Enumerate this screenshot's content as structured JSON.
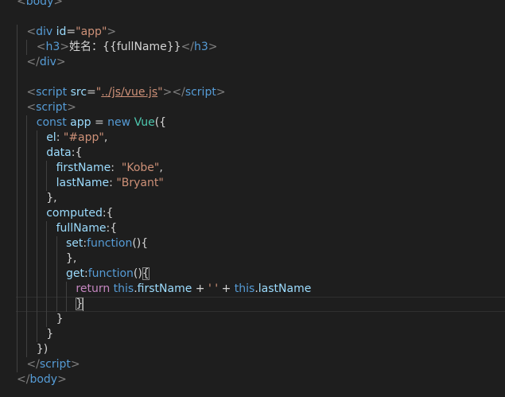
{
  "lines": [
    {
      "indent": 0,
      "tokens": [
        [
          "tag",
          "<"
        ],
        [
          "tname",
          "body"
        ],
        [
          "tag",
          ">"
        ]
      ]
    },
    {
      "indent": 0,
      "tokens": []
    },
    {
      "indent": 1,
      "tokens": [
        [
          "tag",
          "<"
        ],
        [
          "tname",
          "div"
        ],
        [
          "txt",
          " "
        ],
        [
          "attr",
          "id"
        ],
        [
          "txt",
          "="
        ],
        [
          "str",
          "\"app\""
        ],
        [
          "tag",
          ">"
        ]
      ]
    },
    {
      "indent": 2,
      "tokens": [
        [
          "tag",
          "<"
        ],
        [
          "tname",
          "h3"
        ],
        [
          "tag",
          ">"
        ],
        [
          "txt",
          "姓名：{{fullName}}"
        ],
        [
          "tag",
          "</"
        ],
        [
          "tname",
          "h3"
        ],
        [
          "tag",
          ">"
        ]
      ]
    },
    {
      "indent": 1,
      "tokens": [
        [
          "tag",
          "</"
        ],
        [
          "tname",
          "div"
        ],
        [
          "tag",
          ">"
        ]
      ]
    },
    {
      "indent": 1,
      "tokens": []
    },
    {
      "indent": 1,
      "tokens": [
        [
          "tag",
          "<"
        ],
        [
          "tname",
          "script"
        ],
        [
          "txt",
          " "
        ],
        [
          "attr",
          "src"
        ],
        [
          "txt",
          "="
        ],
        [
          "str",
          "\""
        ],
        [
          "link",
          "../js/vue.js"
        ],
        [
          "str",
          "\""
        ],
        [
          "tag",
          "></"
        ],
        [
          "tname",
          "script"
        ],
        [
          "tag",
          ">"
        ]
      ]
    },
    {
      "indent": 1,
      "tokens": [
        [
          "tag",
          "<"
        ],
        [
          "tname",
          "script"
        ],
        [
          "tag",
          ">"
        ]
      ]
    },
    {
      "indent": 2,
      "tokens": [
        [
          "kw",
          "const"
        ],
        [
          "txt",
          " "
        ],
        [
          "prop",
          "app"
        ],
        [
          "txt",
          " = "
        ],
        [
          "kw",
          "new"
        ],
        [
          "txt",
          " "
        ],
        [
          "cls",
          "Vue"
        ],
        [
          "txt",
          "({"
        ]
      ]
    },
    {
      "indent": 3,
      "tokens": [
        [
          "prop",
          "el"
        ],
        [
          "txt",
          ": "
        ],
        [
          "str",
          "\"#app\""
        ],
        [
          "txt",
          ","
        ]
      ]
    },
    {
      "indent": 3,
      "tokens": [
        [
          "prop",
          "data"
        ],
        [
          "txt",
          ":{"
        ]
      ]
    },
    {
      "indent": 4,
      "tokens": [
        [
          "prop",
          "firstName"
        ],
        [
          "txt",
          ":  "
        ],
        [
          "str",
          "\"Kobe\""
        ],
        [
          "txt",
          ","
        ]
      ]
    },
    {
      "indent": 4,
      "tokens": [
        [
          "prop",
          "lastName"
        ],
        [
          "txt",
          ": "
        ],
        [
          "str",
          "\"Bryant\""
        ]
      ]
    },
    {
      "indent": 3,
      "tokens": [
        [
          "txt",
          "},"
        ]
      ]
    },
    {
      "indent": 3,
      "tokens": [
        [
          "prop",
          "computed"
        ],
        [
          "txt",
          ":{"
        ]
      ]
    },
    {
      "indent": 4,
      "tokens": [
        [
          "prop",
          "fullName"
        ],
        [
          "txt",
          ":{"
        ]
      ]
    },
    {
      "indent": 5,
      "tokens": [
        [
          "prop",
          "set"
        ],
        [
          "txt",
          ":"
        ],
        [
          "kw",
          "function"
        ],
        [
          "txt",
          "(){"
        ]
      ]
    },
    {
      "indent": 5,
      "tokens": [
        [
          "txt",
          "},"
        ]
      ]
    },
    {
      "indent": 5,
      "tokens": [
        [
          "prop",
          "get"
        ],
        [
          "txt",
          ":"
        ],
        [
          "kw",
          "function"
        ],
        [
          "txt",
          "()"
        ],
        [
          "hl",
          "{"
        ]
      ]
    },
    {
      "indent": 6,
      "tokens": [
        [
          "kw2",
          "return"
        ],
        [
          "txt",
          " "
        ],
        [
          "kw",
          "this"
        ],
        [
          "txt",
          "."
        ],
        [
          "prop",
          "firstName"
        ],
        [
          "txt",
          " + "
        ],
        [
          "str",
          "' '"
        ],
        [
          "txt",
          " + "
        ],
        [
          "kw",
          "this"
        ],
        [
          "txt",
          "."
        ],
        [
          "prop",
          "lastName"
        ]
      ]
    },
    {
      "indent": 6,
      "tokens": [
        [
          "hl",
          "}"
        ]
      ],
      "cursor": true
    },
    {
      "indent": 4,
      "tokens": [
        [
          "txt",
          "}"
        ]
      ]
    },
    {
      "indent": 3,
      "tokens": [
        [
          "txt",
          "}"
        ]
      ]
    },
    {
      "indent": 2,
      "tokens": [
        [
          "txt",
          "})"
        ]
      ]
    },
    {
      "indent": 1,
      "tokens": [
        [
          "tag",
          "</"
        ],
        [
          "tname",
          "script"
        ],
        [
          "tag",
          ">"
        ]
      ]
    },
    {
      "indent": 0,
      "tokens": [
        [
          "tag",
          "</"
        ],
        [
          "tname",
          "body"
        ],
        [
          "tag",
          ">"
        ]
      ]
    }
  ]
}
